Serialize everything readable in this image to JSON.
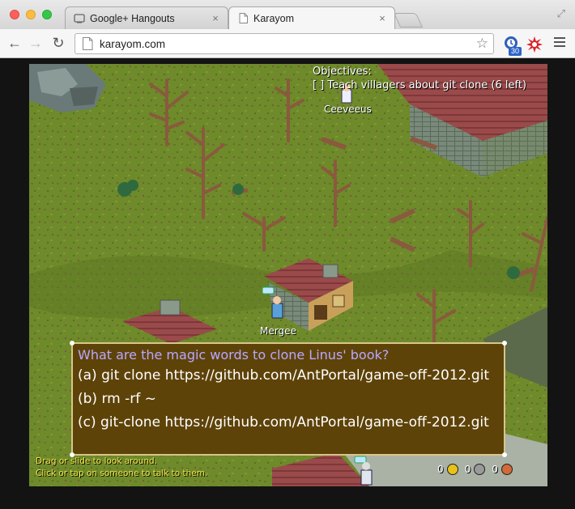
{
  "browser": {
    "tabs": [
      {
        "title": "Google+ Hangouts",
        "close": "×",
        "active": false
      },
      {
        "title": "Karayom",
        "close": "×",
        "active": true
      }
    ],
    "url": "karayom.com",
    "extension_badge": "30"
  },
  "game": {
    "objectives": {
      "title": "Objectives:",
      "items": [
        "[ ] Teach villagers about git clone (6 left)"
      ]
    },
    "npcs": [
      {
        "name": "Ceeveeus"
      },
      {
        "name": "Mergee"
      }
    ],
    "dialog": {
      "question": "What are the magic words to clone Linus' book?",
      "options": [
        "(a) git clone https://github.com/AntPortal/game-off-2012.git",
        "(b) rm -rf ~",
        "(c) git-clone https://github.com/AntPortal/game-off-2012.git"
      ]
    },
    "help": [
      "Drag or slide to look around.",
      "Click or tap on someone to talk to them."
    ],
    "inventory": [
      {
        "count": "0",
        "color": "#e8c21a"
      },
      {
        "count": "0",
        "color": "#9a9a9a"
      },
      {
        "count": "0",
        "color": "#d06a3a"
      }
    ]
  }
}
